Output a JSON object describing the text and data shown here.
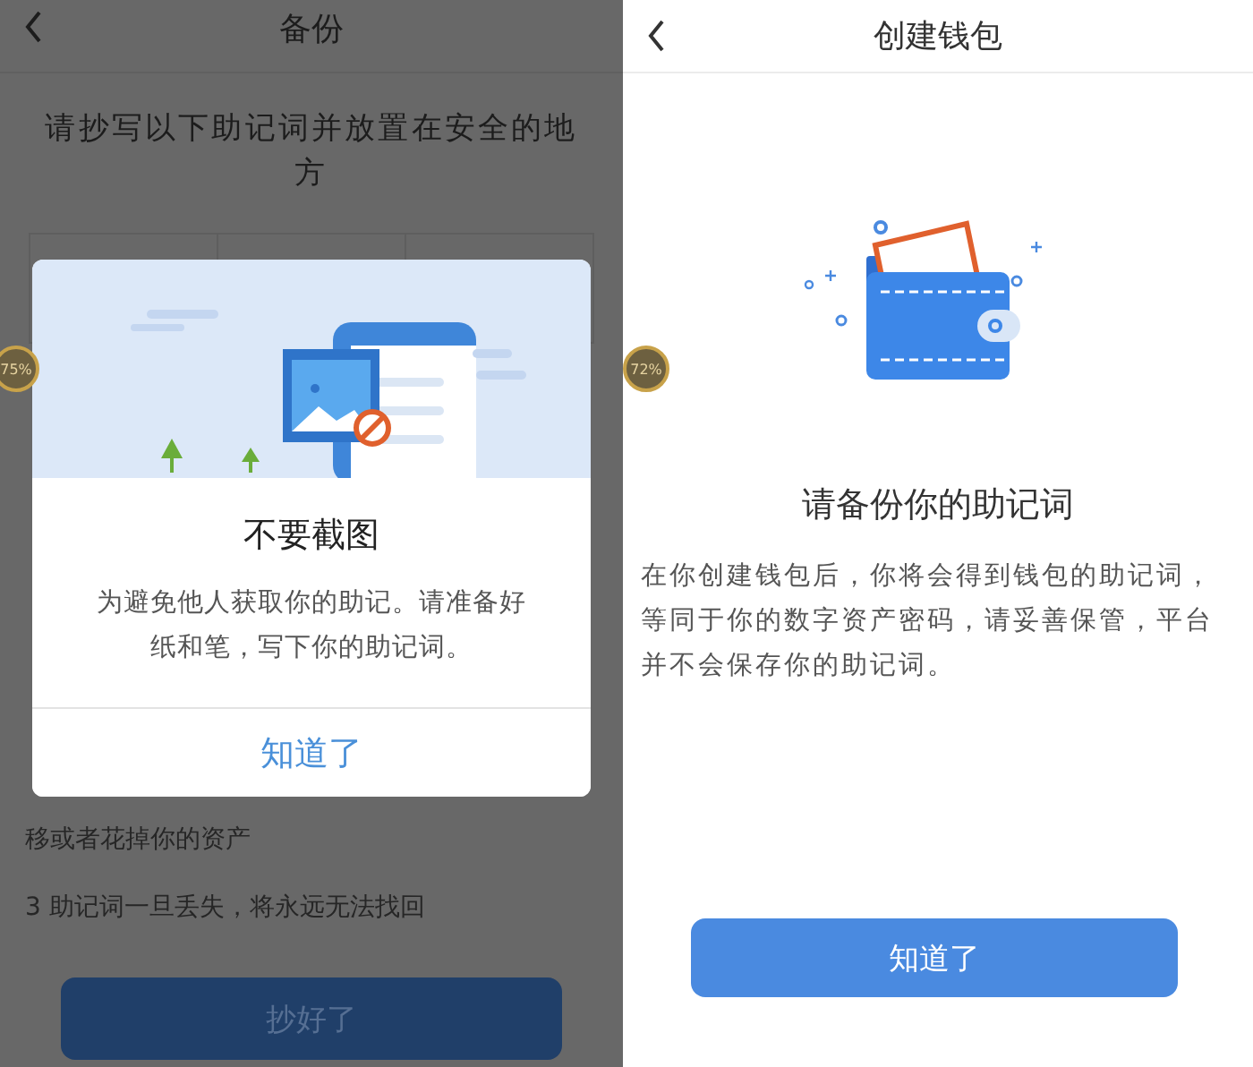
{
  "screens": [
    {
      "kind": "backup",
      "title": "备份",
      "instruction": "请抄写以下助记词并放置在安全的地方",
      "notes": [
        "移或者花掉你的资产",
        "3 助记词一旦丢失，将永远无法找回"
      ],
      "button": "抄好了",
      "float_badge": "75%",
      "dialog": {
        "title": "不要截图",
        "message": "为避免他人获取你的助记。请准备好纸和笔，写下你的助记词。",
        "button": "知道了"
      }
    },
    {
      "kind": "intro",
      "title": "创建钱包",
      "heading": "请备份你的助记词",
      "message": "在你创建钱包后，你将会得到钱包的助记词，等同于你的数字资产密码，请妥善保管，平台并不会保存你的助记词。",
      "button": "知道了",
      "float_badge": "72%"
    }
  ]
}
